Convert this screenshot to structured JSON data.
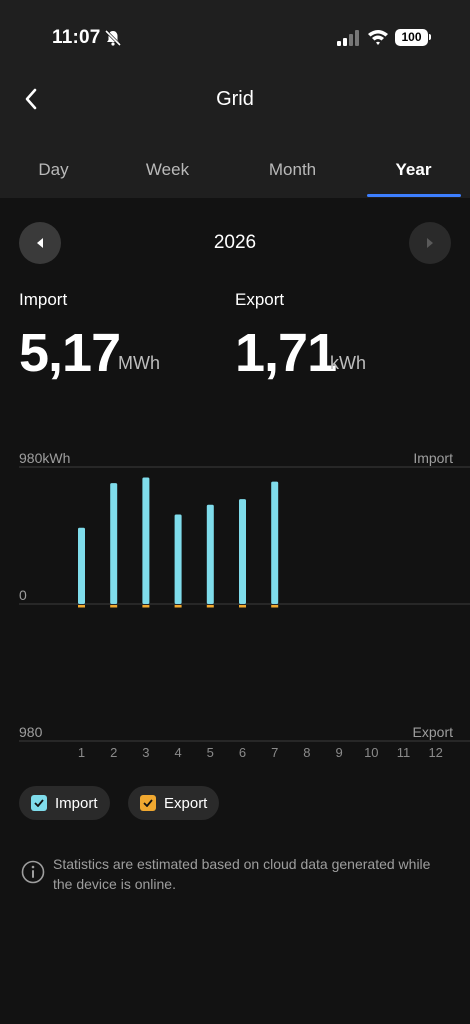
{
  "status_bar": {
    "time": "11:07",
    "battery": "100"
  },
  "header": {
    "title": "Grid"
  },
  "tabs": [
    {
      "label": "Day"
    },
    {
      "label": "Week"
    },
    {
      "label": "Month"
    },
    {
      "label": "Year",
      "active": true
    }
  ],
  "period": {
    "year": "2026"
  },
  "stats": {
    "import": {
      "label": "Import",
      "value": "5,17",
      "unit": "MWh"
    },
    "export": {
      "label": "Export",
      "value": "1,71",
      "unit": "kWh"
    }
  },
  "chart_data": {
    "type": "bar",
    "categories": [
      "1",
      "2",
      "3",
      "4",
      "5",
      "6",
      "7",
      "8",
      "9",
      "10",
      "11",
      "12"
    ],
    "top_axis_label": "980kWh",
    "zero_label": "0",
    "bottom_axis_label": "980",
    "top_series_label": "Import",
    "bottom_series_label": "Export",
    "ylim": [
      -980,
      980
    ],
    "series": [
      {
        "name": "Import",
        "color": "#7fdceb",
        "values": [
          545,
          865,
          905,
          640,
          710,
          750,
          875,
          null,
          null,
          null,
          null,
          null
        ]
      },
      {
        "name": "Export",
        "color": "#f0a830",
        "values": [
          5,
          5,
          5,
          5,
          5,
          5,
          5,
          null,
          null,
          null,
          null,
          null
        ]
      }
    ]
  },
  "legend": [
    {
      "label": "Import",
      "color": "#7fdceb"
    },
    {
      "label": "Export",
      "color": "#f0a830"
    }
  ],
  "note": {
    "text": "Statistics are estimated based on cloud data generated while the device is online."
  }
}
